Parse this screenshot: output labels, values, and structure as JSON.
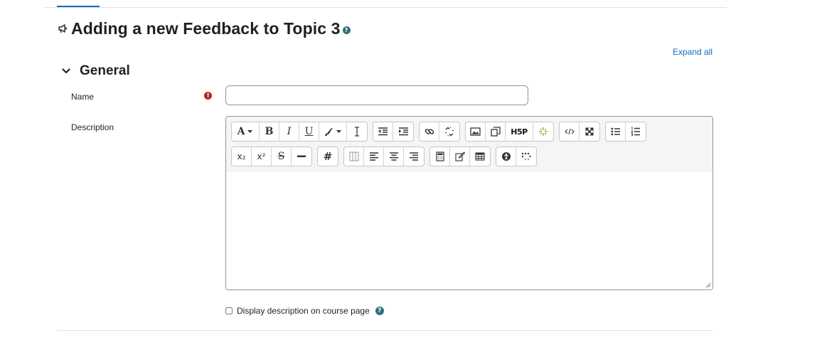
{
  "heading": {
    "title": "Adding a new Feedback to Topic 3",
    "module_icon": "megaphone-icon",
    "help_icon": "question-circle-icon",
    "help_glyph": "?"
  },
  "expand_all_label": "Expand all",
  "general_section": {
    "title": "General",
    "toggle_icon": "chevron-down-icon"
  },
  "fields": {
    "name": {
      "label": "Name",
      "value": "",
      "required_icon": "exclamation-circle-icon",
      "required_glyph": "!"
    },
    "description": {
      "label": "Description",
      "value": "",
      "toolbar_row1": [
        [
          "font-size-icon",
          "bold-icon",
          "italic-icon",
          "underline-icon",
          "font-color-icon",
          "clear-formatting-icon"
        ],
        [
          "outdent-icon",
          "indent-icon"
        ],
        [
          "link-icon",
          "unlink-icon"
        ],
        [
          "image-icon",
          "media-icon",
          "h5p-icon",
          "manage-files-icon"
        ],
        [
          "html-icon",
          "fullscreen-icon"
        ],
        [
          "unordered-list-icon",
          "ordered-list-icon"
        ]
      ],
      "toolbar_row2": [
        [
          "subscript-icon",
          "superscript-icon",
          "strikethrough-icon",
          "horizontal-rule-icon"
        ],
        [
          "special-character-icon"
        ],
        [
          "table-column-icon",
          "align-left-icon",
          "align-center-icon",
          "align-right-icon"
        ],
        [
          "equation-icon",
          "edit-icon",
          "table-icon"
        ],
        [
          "accessibility-checker-icon",
          "screen-reader-helper-icon"
        ]
      ],
      "toolbar_glyphs": {
        "font_size": "A",
        "bold": "B",
        "italic": "I",
        "underline": "U",
        "h5p": "H5P",
        "subscript": "x₂",
        "superscript": "x²",
        "strikethrough": "S",
        "special_char": "#"
      }
    },
    "show_description": {
      "label": "Display description on course page",
      "checked": false,
      "help_icon": "question-circle-icon",
      "help_glyph": "?"
    }
  },
  "colors": {
    "accent": "#0f6cbf",
    "required": "#c31d20",
    "help": "#2f6f7e",
    "toolbar_bg": "#f5f5f5"
  }
}
